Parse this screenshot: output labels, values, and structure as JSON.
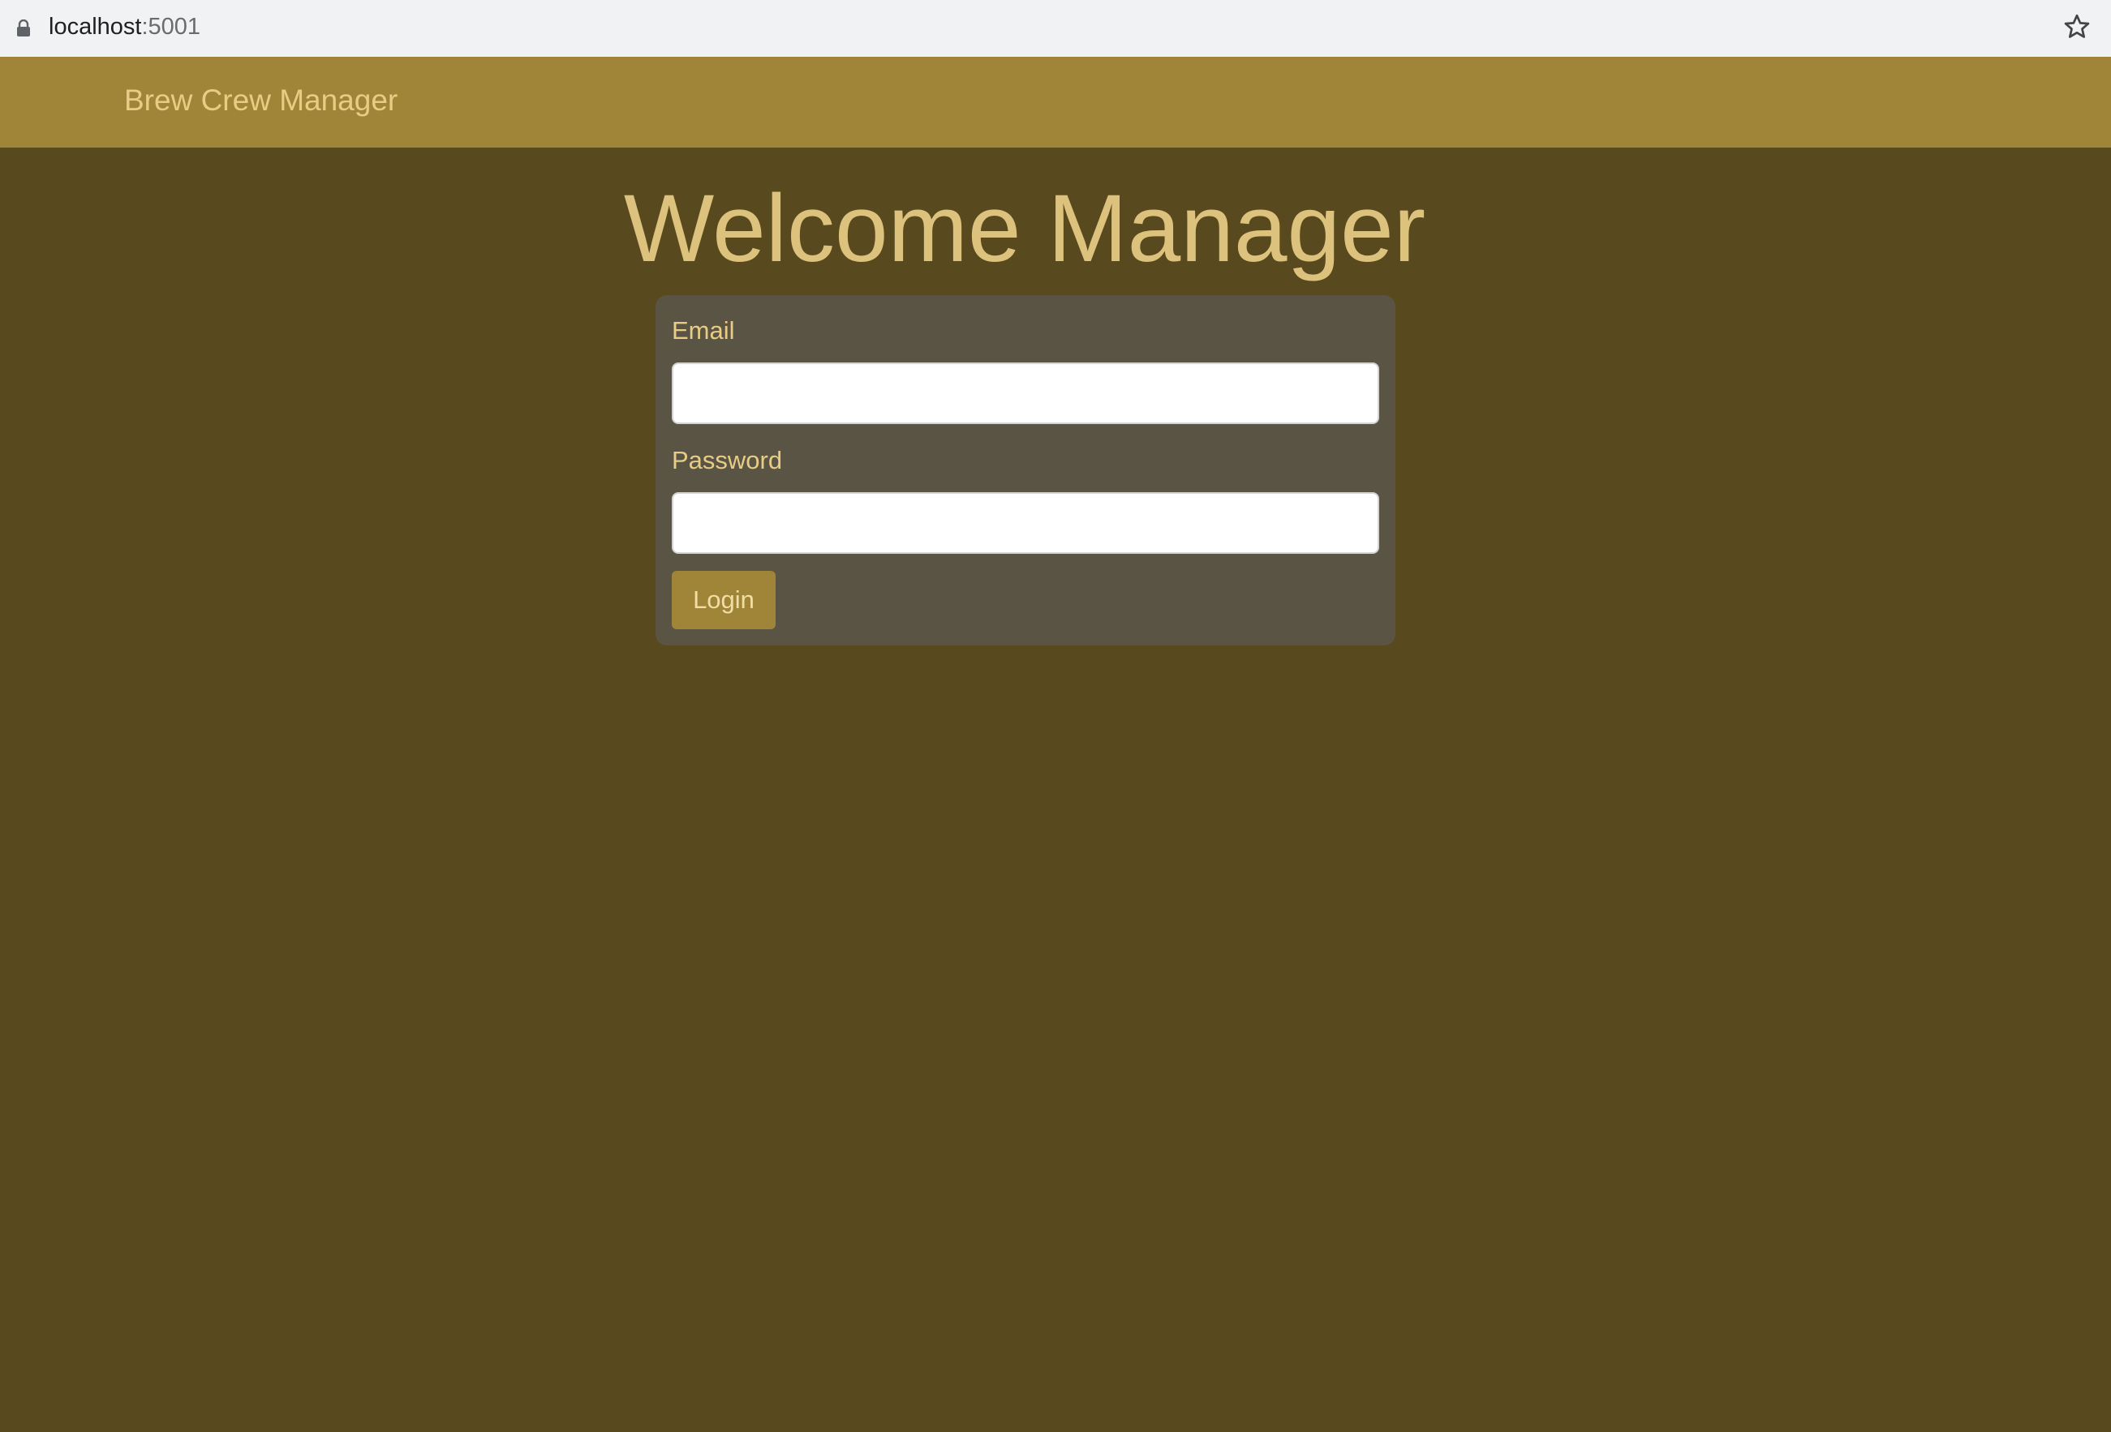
{
  "browser": {
    "url_host": "localhost",
    "url_port": ":5001",
    "lock_icon": "lock-icon",
    "bookmark_icon": "star-icon"
  },
  "navbar": {
    "brand": "Brew Crew Manager"
  },
  "main": {
    "title": "Welcome Manager"
  },
  "login_form": {
    "email_label": "Email",
    "email_value": "",
    "password_label": "Password",
    "password_value": "",
    "submit_label": "Login"
  },
  "colors": {
    "background": "#584a1e",
    "navbar": "#a08538",
    "card": "#5a5444",
    "accent_text": "#e8cc85"
  }
}
